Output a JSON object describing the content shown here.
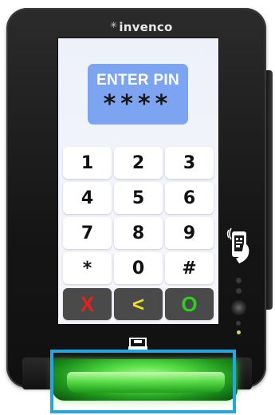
{
  "device": {
    "brand": "invenco",
    "brand_icon": "sparkle-icon"
  },
  "screen": {
    "prompt_title": "ENTER PIN",
    "pin_mask": "****"
  },
  "keypad": {
    "keys": [
      {
        "label": "1",
        "name": "key-1"
      },
      {
        "label": "2",
        "name": "key-2"
      },
      {
        "label": "3",
        "name": "key-3"
      },
      {
        "label": "4",
        "name": "key-4"
      },
      {
        "label": "5",
        "name": "key-5"
      },
      {
        "label": "6",
        "name": "key-6"
      },
      {
        "label": "7",
        "name": "key-7"
      },
      {
        "label": "8",
        "name": "key-8"
      },
      {
        "label": "9",
        "name": "key-9"
      },
      {
        "label": "*",
        "name": "key-star"
      },
      {
        "label": "0",
        "name": "key-0"
      },
      {
        "label": "#",
        "name": "key-hash"
      }
    ],
    "function_keys": [
      {
        "label": "X",
        "name": "cancel-key",
        "color": "#e8211b"
      },
      {
        "label": "<",
        "name": "backspace-key",
        "color": "#f2e21a"
      },
      {
        "label": "O",
        "name": "enter-key",
        "color": "#2ad11e"
      }
    ]
  },
  "colors": {
    "pin_box": "#7ca4f1",
    "highlight": "#25a6e0",
    "reader_glow": "#4fd83f"
  }
}
